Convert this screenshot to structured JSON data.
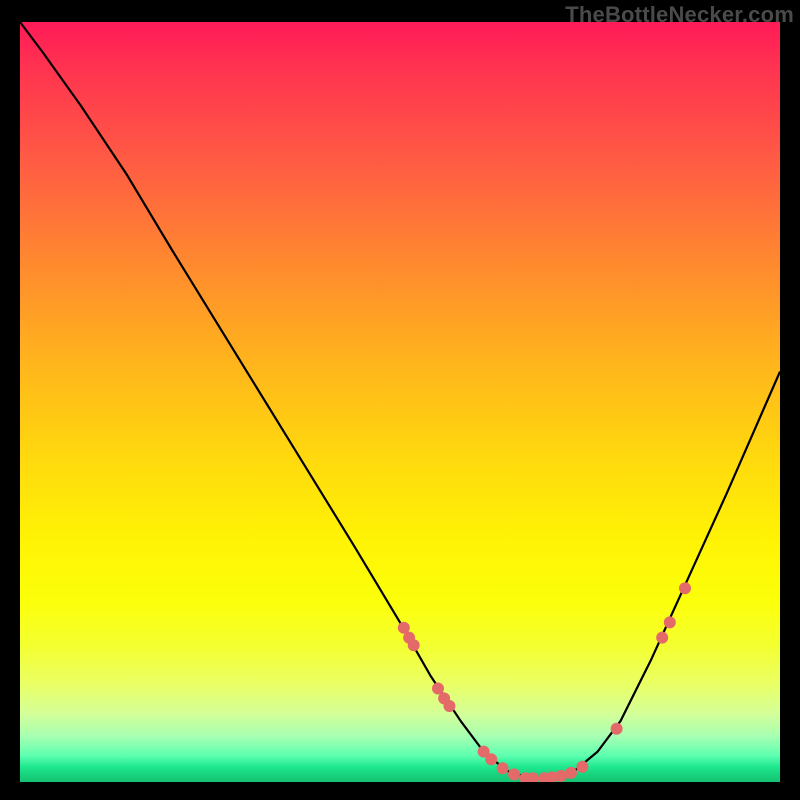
{
  "watermark": "TheBottleNecker.com",
  "chart_data": {
    "type": "line",
    "title": "",
    "xlabel": "",
    "ylabel": "",
    "xlim": [
      0,
      100
    ],
    "ylim": [
      0,
      100
    ],
    "background_gradient": {
      "orientation": "vertical",
      "stops": [
        {
          "pos": 0.0,
          "color": "#ff1a58"
        },
        {
          "pos": 0.18,
          "color": "#ff5a44"
        },
        {
          "pos": 0.45,
          "color": "#ffb51c"
        },
        {
          "pos": 0.68,
          "color": "#fff305"
        },
        {
          "pos": 0.87,
          "color": "#eaff63"
        },
        {
          "pos": 0.96,
          "color": "#5effb0"
        },
        {
          "pos": 1.0,
          "color": "#14c272"
        }
      ]
    },
    "series": [
      {
        "name": "bottleneck-curve",
        "color": "#000000",
        "x": [
          0.0,
          3.0,
          8.0,
          14.0,
          20.0,
          28.0,
          36.0,
          44.0,
          50.0,
          54.0,
          58.0,
          61.0,
          64.0,
          67.0,
          70.0,
          73.0,
          76.0,
          79.0,
          83.0,
          88.0,
          93.0,
          100.0
        ],
        "y": [
          100.0,
          96.0,
          89.0,
          80.0,
          70.0,
          57.0,
          44.0,
          31.0,
          21.0,
          14.0,
          8.0,
          4.0,
          1.5,
          0.5,
          0.5,
          1.5,
          4.0,
          8.0,
          16.0,
          27.0,
          38.0,
          54.0
        ]
      }
    ],
    "scatter": [
      {
        "name": "points-on-curve",
        "color": "#e46a6a",
        "radius": 6,
        "points": [
          {
            "x": 50.5,
            "y": 20.3
          },
          {
            "x": 51.2,
            "y": 19.0
          },
          {
            "x": 51.8,
            "y": 18.0
          },
          {
            "x": 55.0,
            "y": 12.3
          },
          {
            "x": 55.8,
            "y": 11.0
          },
          {
            "x": 56.5,
            "y": 10.0
          },
          {
            "x": 61.0,
            "y": 4.0
          },
          {
            "x": 62.0,
            "y": 3.0
          },
          {
            "x": 63.5,
            "y": 1.8
          },
          {
            "x": 65.0,
            "y": 1.0
          },
          {
            "x": 66.5,
            "y": 0.5
          },
          {
            "x": 67.5,
            "y": 0.5
          },
          {
            "x": 69.0,
            "y": 0.5
          },
          {
            "x": 70.0,
            "y": 0.6
          },
          {
            "x": 71.2,
            "y": 0.8
          },
          {
            "x": 72.5,
            "y": 1.2
          },
          {
            "x": 74.0,
            "y": 2.0
          },
          {
            "x": 78.5,
            "y": 7.0
          },
          {
            "x": 84.5,
            "y": 19.0
          },
          {
            "x": 85.5,
            "y": 21.0
          },
          {
            "x": 87.5,
            "y": 25.5
          }
        ]
      }
    ]
  }
}
